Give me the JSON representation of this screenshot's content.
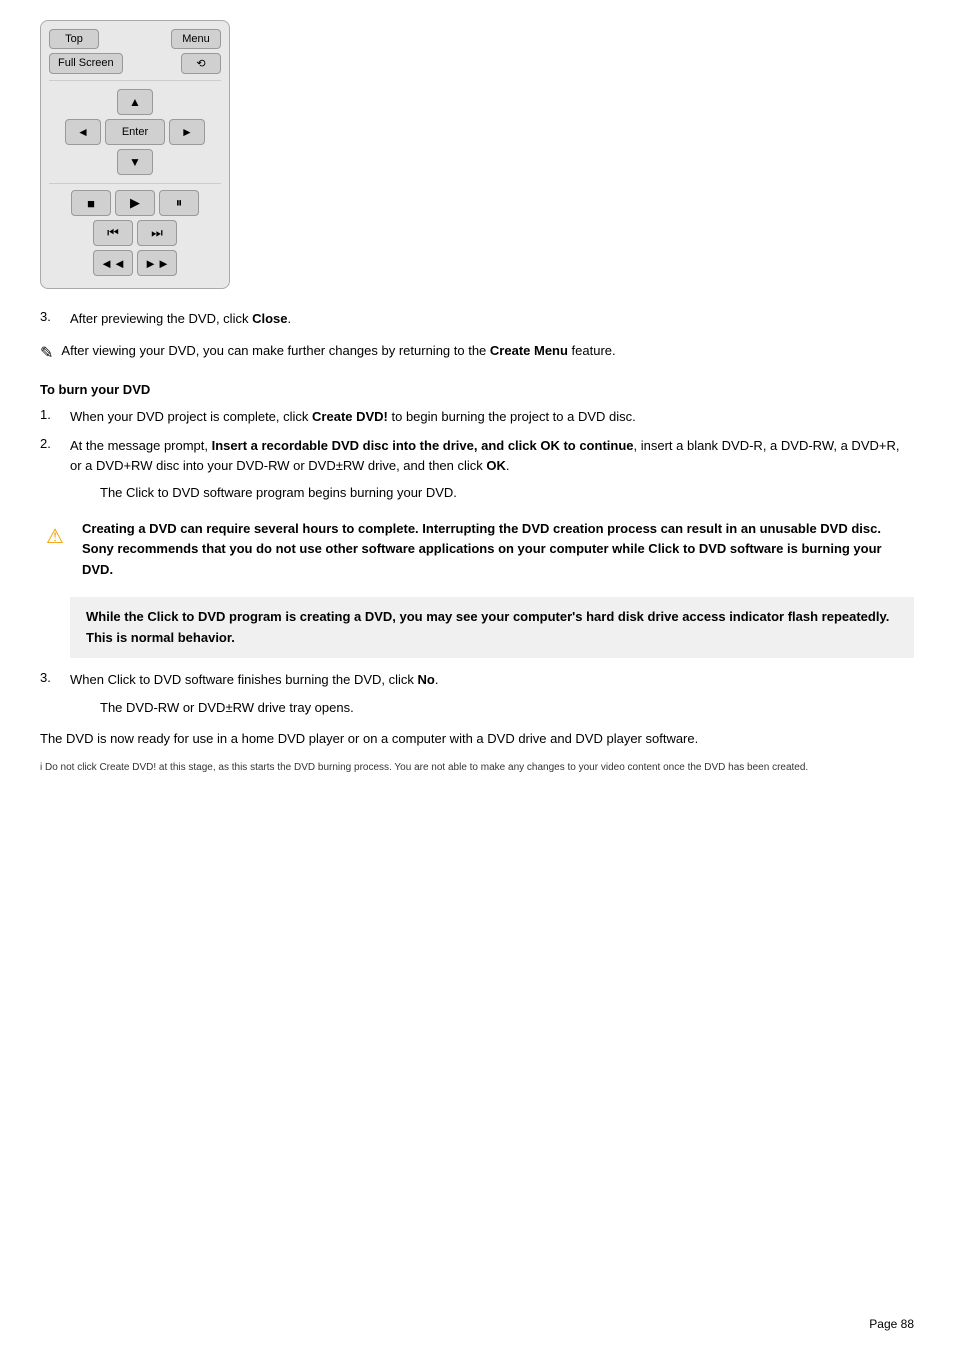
{
  "remote": {
    "btn_top": "Top",
    "btn_menu": "Menu",
    "btn_fullscreen": "Full Screen",
    "btn_angle": "⟳",
    "btn_up": "▲",
    "btn_left": "◄",
    "btn_enter": "Enter",
    "btn_right": "►",
    "btn_down": "▼",
    "btn_stop": "■",
    "btn_play": "►",
    "btn_pause": "❙❙",
    "btn_prev_chapter": "⏮",
    "btn_next_chapter": "⏭",
    "btn_rewind": "◄◄",
    "btn_fastforward": "►►"
  },
  "steps": {
    "step3_label": "3.",
    "step3_text": "After previewing the DVD, click ",
    "step3_bold": "Close",
    "step3_end": ".",
    "note_text": "After viewing your DVD, you can make further changes by returning to the ",
    "note_bold": "Create Menu",
    "note_end": " feature.",
    "section_heading": "To burn your DVD",
    "burn_step1_label": "1.",
    "burn_step1_text": "When your DVD project is complete, click ",
    "burn_step1_bold": "Create DVD!",
    "burn_step1_end": " to begin burning the project to a DVD disc.",
    "burn_step2_label": "2.",
    "burn_step2_text": "At the message prompt, ",
    "burn_step2_bold": "Insert a recordable DVD disc into the drive, and click OK to continue",
    "burn_step2_end": ", insert a blank DVD-R, a DVD-RW, a DVD+R, or a DVD+RW disc into your DVD-RW or DVD±RW drive, and then click ",
    "burn_step2_ok": "OK",
    "burn_step2_period": ".",
    "sub_text": "The Click to DVD   software program begins burning your DVD.",
    "warning_text": "Creating a DVD can require several hours to complete. Interrupting the DVD creation process can result in an unusable DVD disc. Sony recommends that you do not use other software applications on your computer while Click to DVD software is burning your DVD.",
    "info_text": "While the Click to DVD program is creating a DVD, you may see your computer's hard disk drive access indicator flash repeatedly. This is normal behavior.",
    "burn_step3_label": "3.",
    "burn_step3_text": "When Click to DVD software finishes burning the DVD, click ",
    "burn_step3_bold": "No",
    "burn_step3_end": ".",
    "sub2_text": "The DVD-RW or DVD±RW drive tray opens.",
    "final_text": "The DVD is now ready for use in a home DVD player or on a computer with a DVD drive and DVD player software.",
    "footnote_text": "Do not click Create DVD! at this stage, as this starts the DVD burning process. You are not able to make any changes to your video content once the DVD has been created.",
    "page_number": "Page 88"
  }
}
